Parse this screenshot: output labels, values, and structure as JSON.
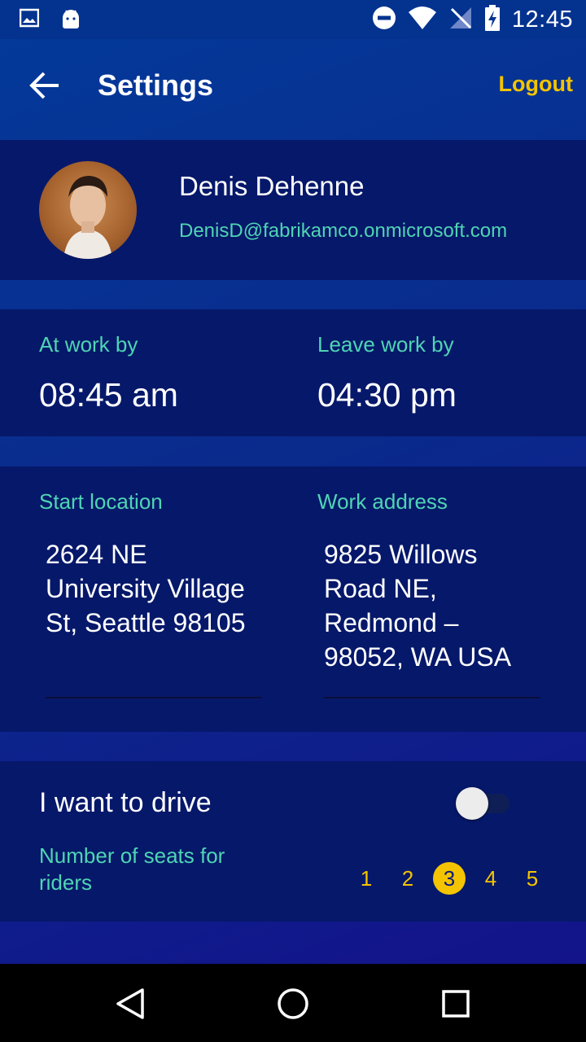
{
  "status_bar": {
    "time": "12:45",
    "left_icons": [
      "image-icon",
      "android-icon"
    ],
    "right_icons": [
      "do-not-disturb-icon",
      "wifi-icon",
      "no-signal-icon",
      "battery-charging-icon"
    ]
  },
  "app_bar": {
    "title": "Settings",
    "logout_label": "Logout"
  },
  "profile": {
    "name": "Denis Dehenne",
    "email": "DenisD@fabrikamco.onmicrosoft.com"
  },
  "schedule": {
    "at_work_label": "At work by",
    "at_work_value": "08:45 am",
    "leave_work_label": "Leave work by",
    "leave_work_value": "04:30 pm"
  },
  "addresses": {
    "start_label": "Start location",
    "start_value": "2624 NE University Village St, Seattle 98105",
    "work_label": "Work address",
    "work_value": "9825 Willows Road NE, Redmond – 98052, WA USA"
  },
  "drive": {
    "label": "I want to drive",
    "toggle_on": false,
    "seats_label": "Number of seats for riders",
    "seats": [
      "1",
      "2",
      "3",
      "4",
      "5"
    ],
    "selected_seat": "3"
  },
  "colors": {
    "accent_yellow": "#f4c400",
    "label_teal": "#4fd4b4",
    "card_bg": "#06186a"
  }
}
